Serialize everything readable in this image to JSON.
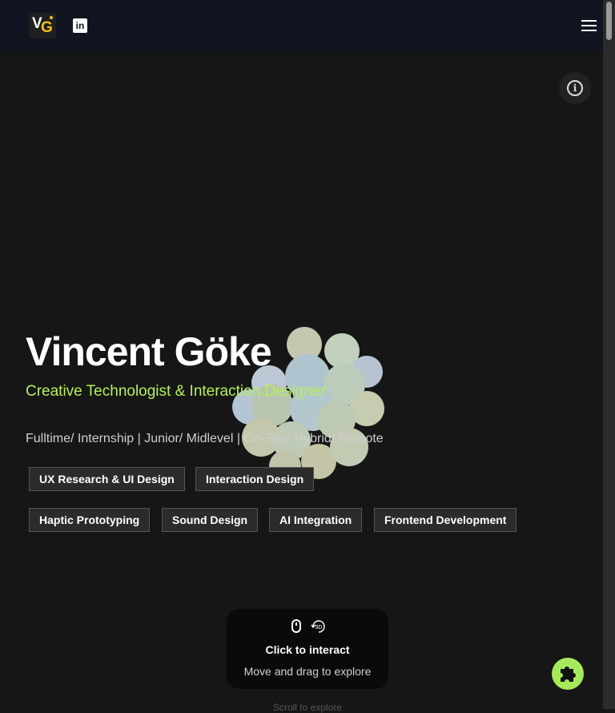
{
  "header": {
    "logo_v": "V",
    "logo_g": "G",
    "linkedin_label": "in",
    "menu_icon": "hamburger-menu-icon"
  },
  "hero": {
    "name": "Vincent Göke",
    "subtitle": "Creative Technologist & Interaction Designer",
    "availability": "Fulltime/ Internship | Junior/ Midlevel | On-Site/ Hybrid/ Remote",
    "tags": [
      "UX Research & UI Design",
      "Interaction Design",
      "Haptic Prototyping",
      "Sound Design",
      "AI Integration",
      "Frontend Development"
    ]
  },
  "interaction_hint": {
    "title": "Click to interact",
    "subtitle": "Move and drag to explore",
    "icon_3d_label": "3D"
  },
  "scroll_cue": "Scroll to explore",
  "info_button": {
    "glyph": "i"
  },
  "colors": {
    "background": "#161616",
    "header": "#0f1420",
    "accent": "#b5f05a",
    "logo_accent": "#f1c40f",
    "puzzle_button": "#a6ea5b"
  }
}
